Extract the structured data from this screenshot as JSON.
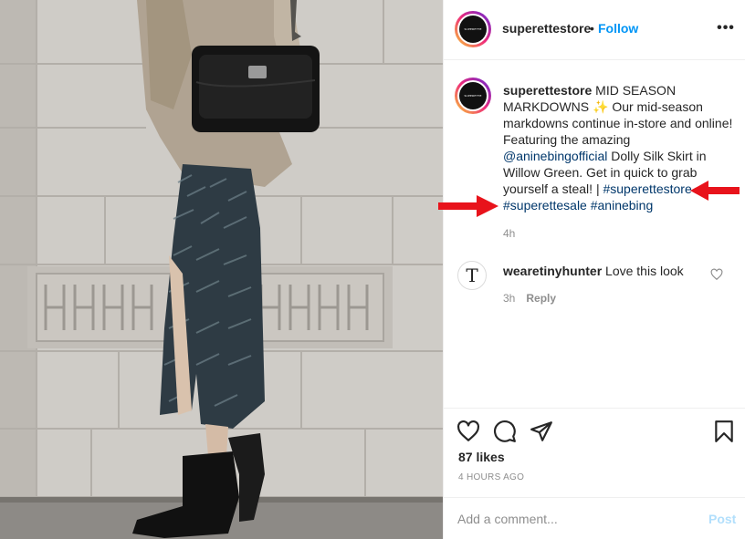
{
  "header": {
    "username": "superettestore",
    "separator": "•",
    "follow_label": "Follow",
    "more_label": "•••",
    "avatar_text": "SUPERETTE"
  },
  "caption": {
    "username": "superettestore",
    "text_1": " MID SEASON MARKDOWNS ",
    "emoji": "✨",
    "text_2": " Our mid-season markdowns continue in-store and online! Featuring the amazing ",
    "mention": "@aninebingofficial",
    "text_3": " Dolly Silk Skirt in Willow Green. Get in quick to grab yourself a steal! | ",
    "hashtags": [
      "#superettestore",
      "#superettesale",
      "#aninebing"
    ],
    "time": "4h"
  },
  "comment": {
    "avatar_letter": "T",
    "username": "wearetinyhunter",
    "text": "Love this look",
    "time": "3h",
    "reply_label": "Reply"
  },
  "actions": {
    "like_icon": "heart-icon",
    "comment_icon": "comment-icon",
    "share_icon": "share-icon",
    "save_icon": "bookmark-icon",
    "likes": "87 likes",
    "posted": "4 HOURS AGO"
  },
  "add_comment": {
    "placeholder": "Add a comment...",
    "post_label": "Post"
  },
  "colors": {
    "link": "#0095f6",
    "hashtag": "#00376b",
    "muted": "#8e8e8e",
    "annotation_arrow": "#e8131b"
  }
}
